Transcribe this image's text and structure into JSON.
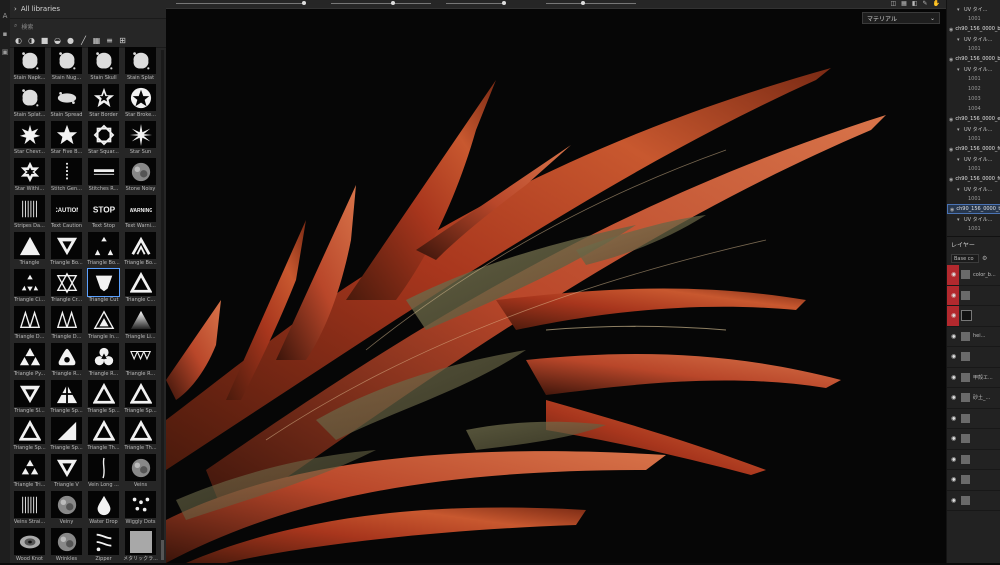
{
  "shelf": {
    "header": "All libraries",
    "search_placeholder": "検索",
    "filter_icons": [
      "alpha-icon",
      "brush-icon",
      "square-icon",
      "half-circle-icon",
      "sphere-icon",
      "line-icon",
      "grid-icon",
      "text-icon",
      "more-grid-icon"
    ],
    "items": [
      {
        "label": "Stain Napk...",
        "icon": "splat"
      },
      {
        "label": "Stain Nug...",
        "icon": "splat"
      },
      {
        "label": "Stain Skull",
        "icon": "splat"
      },
      {
        "label": "Stain Splat",
        "icon": "splat"
      },
      {
        "label": "Stain Splat...",
        "icon": "splat"
      },
      {
        "label": "Stain Spread",
        "icon": "spread"
      },
      {
        "label": "Star Border",
        "icon": "star-border"
      },
      {
        "label": "Star Broke...",
        "icon": "star-broken"
      },
      {
        "label": "Star Chevr...",
        "icon": "star-chevron"
      },
      {
        "label": "Star Five B...",
        "icon": "star"
      },
      {
        "label": "Star Squar...",
        "icon": "star-square"
      },
      {
        "label": "Star Sun",
        "icon": "star-sun"
      },
      {
        "label": "Star Withi...",
        "icon": "star-within"
      },
      {
        "label": "Stitch Gen...",
        "icon": "stitch"
      },
      {
        "label": "Stitches R...",
        "icon": "bar"
      },
      {
        "label": "Stone Noisy",
        "icon": "noise"
      },
      {
        "label": "Stripes Da...",
        "icon": "stripes"
      },
      {
        "label": "Text Caution",
        "icon": "text-caution"
      },
      {
        "label": "Text Stop",
        "icon": "text-stop"
      },
      {
        "label": "Text Warni...",
        "icon": "text-warning"
      },
      {
        "label": "Triangle",
        "icon": "triangle"
      },
      {
        "label": "Triangle Bo...",
        "icon": "triangle-down"
      },
      {
        "label": "Triangle Bo...",
        "icon": "triangle-corners"
      },
      {
        "label": "Triangle Bo...",
        "icon": "triangle-chevron"
      },
      {
        "label": "Triangle Ci...",
        "icon": "triangle-circle"
      },
      {
        "label": "Triangle Cr...",
        "icon": "triangle-cross"
      },
      {
        "label": "Triangle Cut",
        "icon": "triangle-cut"
      },
      {
        "label": "Triangle C...",
        "icon": "triangle-outline"
      },
      {
        "label": "Triangle D...",
        "icon": "triangle-double"
      },
      {
        "label": "Triangle D...",
        "icon": "triangle-double"
      },
      {
        "label": "Triangle In...",
        "icon": "triangle-in"
      },
      {
        "label": "Triangle Li...",
        "icon": "triangle-linear"
      },
      {
        "label": "Triangle Py...",
        "icon": "triangle-pyramid"
      },
      {
        "label": "Triangle R...",
        "icon": "triangle-round"
      },
      {
        "label": "Triangle R...",
        "icon": "triangle-trefoil"
      },
      {
        "label": "Triangle R...",
        "icon": "triangle-row"
      },
      {
        "label": "Triangle Sl...",
        "icon": "triangle-down"
      },
      {
        "label": "Triangle Sp...",
        "icon": "triangle-split"
      },
      {
        "label": "Triangle Sp...",
        "icon": "triangle-outline"
      },
      {
        "label": "Triangle Sp...",
        "icon": "triangle-outline"
      },
      {
        "label": "Triangle Sp...",
        "icon": "triangle-outline"
      },
      {
        "label": "Triangle Sp...",
        "icon": "triangle-right"
      },
      {
        "label": "Triangle Th...",
        "icon": "triangle-outline"
      },
      {
        "label": "Triangle Th...",
        "icon": "triangle-outline"
      },
      {
        "label": "Triangle Tri...",
        "icon": "triangle-tri"
      },
      {
        "label": "Triangle V",
        "icon": "triangle-down"
      },
      {
        "label": "Vein Long ...",
        "icon": "vein"
      },
      {
        "label": "Veins",
        "icon": "noise"
      },
      {
        "label": "Veins Strai...",
        "icon": "stripes"
      },
      {
        "label": "Veiny",
        "icon": "noise"
      },
      {
        "label": "Water Drop",
        "icon": "drop"
      },
      {
        "label": "Wiggly Dots",
        "icon": "dots"
      },
      {
        "label": "Wood Knot",
        "icon": "knot"
      },
      {
        "label": "Wrinkles",
        "icon": "noise"
      },
      {
        "label": "Zipper",
        "icon": "zipper"
      },
      {
        "label": "メタリックラ...",
        "icon": "metal"
      }
    ]
  },
  "viewport": {
    "dropdown_label": "マテリアル"
  },
  "texture_sets": [
    {
      "label": "UV タイ...",
      "kind": "uv"
    },
    {
      "label": "1001",
      "kind": "sub"
    },
    {
      "label": "ch90_156_0000_bo...",
      "kind": "tex"
    },
    {
      "label": "UV タイル...",
      "kind": "uv"
    },
    {
      "label": "1001",
      "kind": "sub"
    },
    {
      "label": "ch90_156_0000_bo...",
      "kind": "tex"
    },
    {
      "label": "UV タイル...",
      "kind": "uv"
    },
    {
      "label": "1001",
      "kind": "sub"
    },
    {
      "label": "1002",
      "kind": "sub"
    },
    {
      "label": "1003",
      "kind": "sub"
    },
    {
      "label": "1004",
      "kind": "sub"
    },
    {
      "label": "ch90_156_0000_ey...",
      "kind": "tex"
    },
    {
      "label": "UV タイル...",
      "kind": "uv"
    },
    {
      "label": "1001",
      "kind": "sub"
    },
    {
      "label": "ch90_156_0000_fu...",
      "kind": "tex"
    },
    {
      "label": "UV タイル...",
      "kind": "uv"
    },
    {
      "label": "1001",
      "kind": "sub"
    },
    {
      "label": "ch90_156_0000_fu...",
      "kind": "tex"
    },
    {
      "label": "UV タイル...",
      "kind": "uv"
    },
    {
      "label": "1001",
      "kind": "sub"
    },
    {
      "label": "ch90_156_0000_te...",
      "kind": "tex-selected"
    },
    {
      "label": "UV タイル...",
      "kind": "uv"
    },
    {
      "label": "1001",
      "kind": "sub"
    }
  ],
  "layers": {
    "title": "レイヤー",
    "blend_mode": "Base co",
    "items": [
      {
        "label": "color_b...",
        "red": true,
        "swatch": "mid"
      },
      {
        "label": "",
        "red": true,
        "swatch": "mid"
      },
      {
        "label": "",
        "red": true,
        "swatch": "dark"
      },
      {
        "label": "hei...",
        "red": false,
        "swatch": "mid"
      },
      {
        "label": "",
        "red": false,
        "swatch": "mid"
      },
      {
        "label": "甲殻エ...",
        "red": false,
        "swatch": "mid"
      },
      {
        "label": "砂土_...",
        "red": false,
        "swatch": "mid"
      },
      {
        "label": "",
        "red": false,
        "swatch": "mid"
      },
      {
        "label": "",
        "red": false,
        "swatch": "mid"
      },
      {
        "label": "",
        "red": false,
        "swatch": "mid"
      },
      {
        "label": "",
        "red": false,
        "swatch": "mid"
      },
      {
        "label": "",
        "red": false,
        "swatch": "mid"
      }
    ]
  }
}
